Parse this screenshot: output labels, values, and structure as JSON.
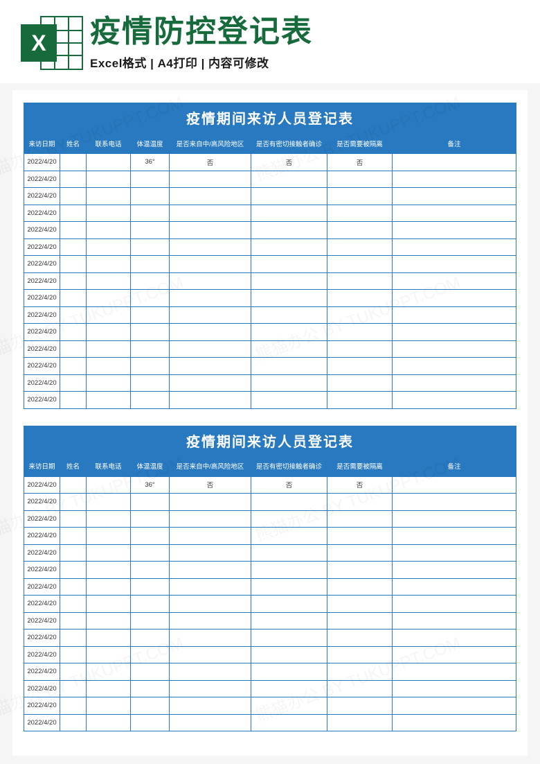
{
  "banner": {
    "title": "疫情防控登记表",
    "subtitle": "Excel格式 | A4打印 | 内容可修改",
    "iconLetter": "X"
  },
  "form": {
    "title": "疫情期间来访人员登记表",
    "columns": [
      "来访日期",
      "姓名",
      "联系电话",
      "体温温度",
      "是否来自中/高风险地区",
      "是否有密切接触者确诊",
      "是否需要被隔离",
      "备注"
    ],
    "rows": [
      {
        "date": "2022/4/20",
        "name": "",
        "phone": "",
        "temp": "36°",
        "risk": "否",
        "contact": "否",
        "quarantine": "否",
        "note": ""
      },
      {
        "date": "2022/4/20",
        "name": "",
        "phone": "",
        "temp": "",
        "risk": "",
        "contact": "",
        "quarantine": "",
        "note": ""
      },
      {
        "date": "2022/4/20",
        "name": "",
        "phone": "",
        "temp": "",
        "risk": "",
        "contact": "",
        "quarantine": "",
        "note": ""
      },
      {
        "date": "2022/4/20",
        "name": "",
        "phone": "",
        "temp": "",
        "risk": "",
        "contact": "",
        "quarantine": "",
        "note": ""
      },
      {
        "date": "2022/4/20",
        "name": "",
        "phone": "",
        "temp": "",
        "risk": "",
        "contact": "",
        "quarantine": "",
        "note": ""
      },
      {
        "date": "2022/4/20",
        "name": "",
        "phone": "",
        "temp": "",
        "risk": "",
        "contact": "",
        "quarantine": "",
        "note": ""
      },
      {
        "date": "2022/4/20",
        "name": "",
        "phone": "",
        "temp": "",
        "risk": "",
        "contact": "",
        "quarantine": "",
        "note": ""
      },
      {
        "date": "2022/4/20",
        "name": "",
        "phone": "",
        "temp": "",
        "risk": "",
        "contact": "",
        "quarantine": "",
        "note": ""
      },
      {
        "date": "2022/4/20",
        "name": "",
        "phone": "",
        "temp": "",
        "risk": "",
        "contact": "",
        "quarantine": "",
        "note": ""
      },
      {
        "date": "2022/4/20",
        "name": "",
        "phone": "",
        "temp": "",
        "risk": "",
        "contact": "",
        "quarantine": "",
        "note": ""
      },
      {
        "date": "2022/4/20",
        "name": "",
        "phone": "",
        "temp": "",
        "risk": "",
        "contact": "",
        "quarantine": "",
        "note": ""
      },
      {
        "date": "2022/4/20",
        "name": "",
        "phone": "",
        "temp": "",
        "risk": "",
        "contact": "",
        "quarantine": "",
        "note": ""
      },
      {
        "date": "2022/4/20",
        "name": "",
        "phone": "",
        "temp": "",
        "risk": "",
        "contact": "",
        "quarantine": "",
        "note": ""
      },
      {
        "date": "2022/4/20",
        "name": "",
        "phone": "",
        "temp": "",
        "risk": "",
        "contact": "",
        "quarantine": "",
        "note": ""
      },
      {
        "date": "2022/4/20",
        "name": "",
        "phone": "",
        "temp": "",
        "risk": "",
        "contact": "",
        "quarantine": "",
        "note": ""
      }
    ]
  },
  "watermarkText": "熊猫办公 BY TUKUPPT.COM"
}
